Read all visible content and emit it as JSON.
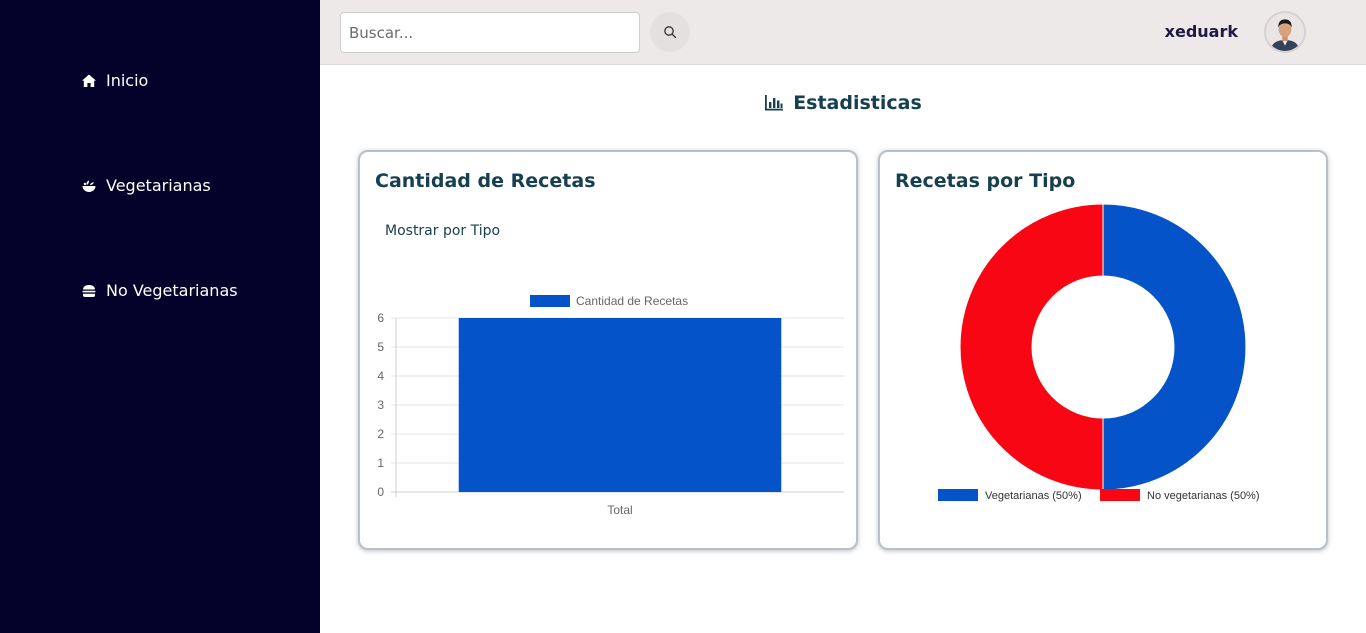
{
  "sidebar": {
    "items": [
      {
        "label": "Inicio",
        "icon": "home-icon"
      },
      {
        "label": "Vegetarianas",
        "icon": "salad-bowl-icon"
      },
      {
        "label": "No Vegetarianas",
        "icon": "burger-icon"
      }
    ]
  },
  "header": {
    "search_placeholder": "Buscar...",
    "search_value": "",
    "username": "xeduark"
  },
  "main": {
    "title": "Estadisticas",
    "title_icon": "chart-bar-icon"
  },
  "cards": {
    "left": {
      "title": "Cantidad de Recetas",
      "link": "Mostrar por Tipo"
    },
    "right": {
      "title": "Recetas por Tipo"
    }
  },
  "colors": {
    "sidebar_bg": "#04022b",
    "topbar_bg": "#ede9e8",
    "title_color": "#163f4f",
    "vegetarianas": "#0453c8",
    "no_vegetarianas": "#f90614"
  },
  "chart_data": [
    {
      "type": "bar",
      "categories": [
        "Total"
      ],
      "series": [
        {
          "name": "Cantidad de Recetas",
          "values": [
            6
          ],
          "color": "#0453c8"
        }
      ],
      "ylim": [
        0,
        6
      ],
      "yticks": [
        0,
        1,
        2,
        3,
        4,
        5,
        6
      ],
      "grid": true,
      "legend": "top"
    },
    {
      "type": "pie",
      "donut": true,
      "labels": [
        "Vegetarianas (50%)",
        "No vegetarianas (50%)"
      ],
      "values": [
        50,
        50
      ],
      "colors": [
        "#0453c8",
        "#f90614"
      ],
      "legend": "bottom"
    }
  ]
}
